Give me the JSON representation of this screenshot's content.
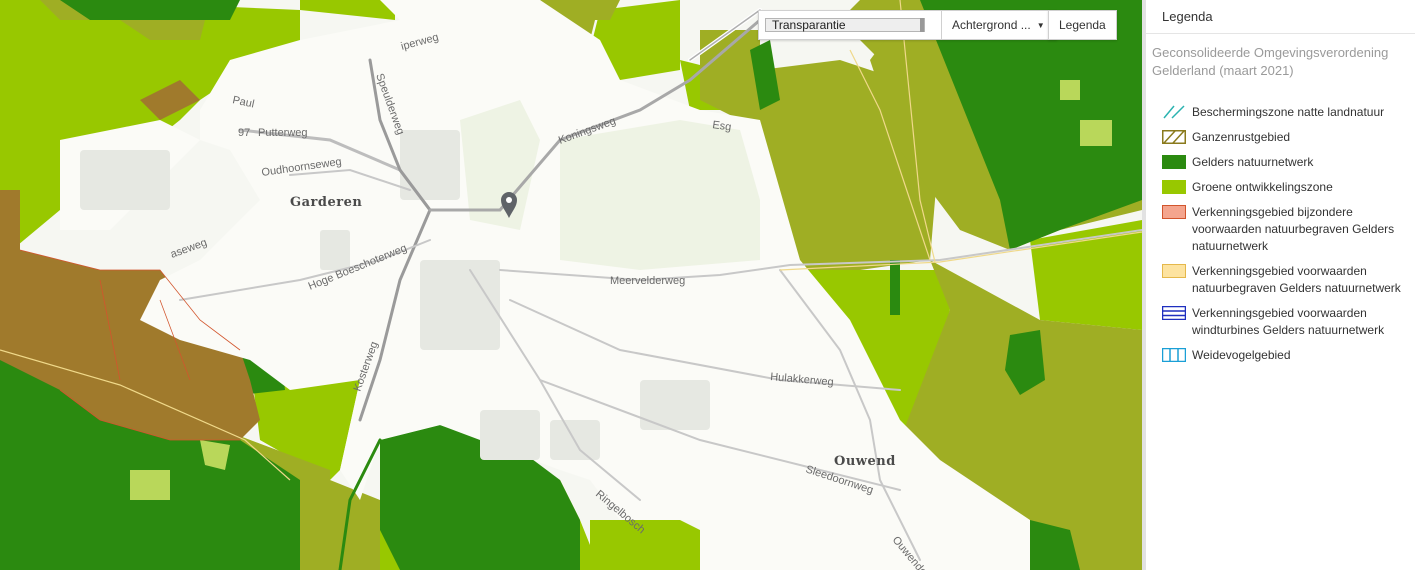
{
  "toolbar": {
    "transparency_label": "Transparantie",
    "transparency_value": 0.98,
    "background_label": "Achtergrond ...",
    "legend_button_label": "Legenda"
  },
  "legend": {
    "title": "Legenda",
    "subtitle": "Geconsolideerde Omgevingsverordening Gelderland (maart 2021)",
    "items": [
      {
        "label": "Beschermingszone natte landnatuur",
        "icon": "diagonal-lines-cyan",
        "color": "#2bb3b0"
      },
      {
        "label": "Ganzenrustgebied",
        "icon": "hatched-olive",
        "color": "#8a7a1c"
      },
      {
        "label": "Gelders natuurnetwerk",
        "icon": "solid",
        "color": "#2b8a10"
      },
      {
        "label": "Groene ontwikkelingszone",
        "icon": "solid",
        "color": "#98c800"
      },
      {
        "label": "Verkenningsgebied bijzondere voorwaarden natuurbegraven Gelders natuurnetwerk",
        "icon": "solid-outline",
        "color": "#f4a58e"
      },
      {
        "label": "Verkenningsgebied voorwaarden natuurbegraven Gelders natuurnetwerk",
        "icon": "solid-outline",
        "color": "#fde3a0"
      },
      {
        "label": "Verkenningsgebied voorwaarden windturbines Gelders natuurnetwerk",
        "icon": "horizontal-lines-blue",
        "color": "#1f2fbf"
      },
      {
        "label": "Weidevogelgebied",
        "icon": "vertical-lines-cyan",
        "color": "#1a9fd6"
      }
    ]
  },
  "map": {
    "place_labels": [
      "Garderen",
      "Ouwend"
    ],
    "road_labels": [
      "Speulderweg",
      "Koningsweg",
      "Putterweg",
      "Oudhoornseweg",
      "Hoge Boeschoterweg",
      "Meervelderweg",
      "Hulakkerweg",
      "Sleedoornweg",
      "Ringelbosch",
      "Ouwendorp",
      "Esg",
      "Kosterweg",
      "Paul",
      "aseweg",
      "iperweg",
      "97"
    ],
    "marker_icon": "map-pin-icon"
  }
}
